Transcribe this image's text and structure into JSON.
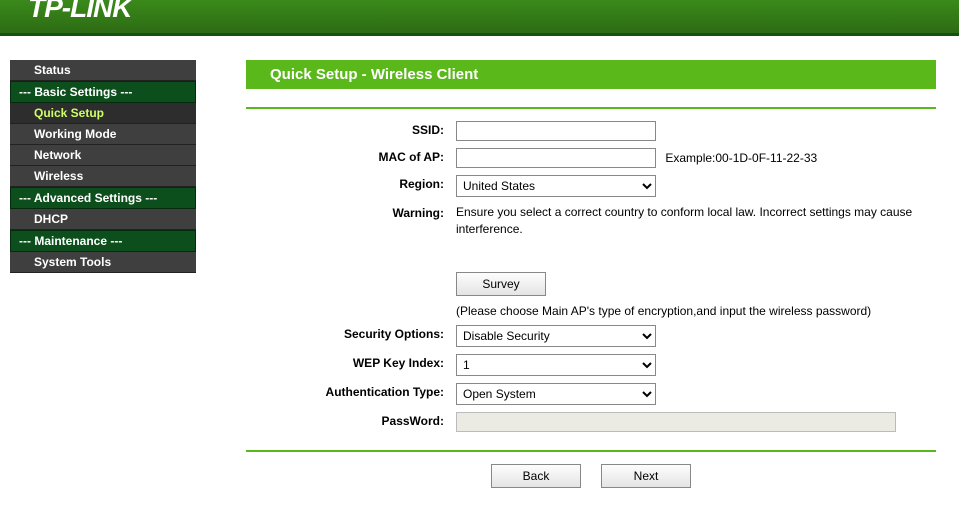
{
  "logo": "TP-LINK",
  "sidebar": {
    "items": [
      {
        "type": "item",
        "label": "Status"
      },
      {
        "type": "header",
        "label": "--- Basic Settings ---"
      },
      {
        "type": "item",
        "label": "Quick Setup",
        "active": true
      },
      {
        "type": "item",
        "label": "Working Mode"
      },
      {
        "type": "item",
        "label": "Network"
      },
      {
        "type": "item",
        "label": "Wireless"
      },
      {
        "type": "header",
        "label": "--- Advanced Settings ---"
      },
      {
        "type": "item",
        "label": "DHCP"
      },
      {
        "type": "header",
        "label": "--- Maintenance ---"
      },
      {
        "type": "item",
        "label": "System Tools"
      }
    ]
  },
  "page": {
    "title": "Quick Setup - Wireless Client",
    "ssid_label": "SSID:",
    "ssid_value": "",
    "mac_label": "MAC of AP:",
    "mac_value": "",
    "mac_example": "Example:00-1D-0F-11-22-33",
    "region_label": "Region:",
    "region_value": "United States",
    "warning_label": "Warning:",
    "warning_text": "Ensure you select a correct country to conform local law. Incorrect settings may cause interference.",
    "survey_btn": "Survey",
    "survey_note": "(Please choose Main AP's type of encryption,and input the wireless password)",
    "security_label": "Security Options:",
    "security_value": "Disable Security",
    "wep_label": "WEP Key Index:",
    "wep_value": "1",
    "auth_label": "Authentication Type:",
    "auth_value": "Open System",
    "password_label": "PassWord:",
    "password_value": "",
    "back_btn": "Back",
    "next_btn": "Next"
  }
}
